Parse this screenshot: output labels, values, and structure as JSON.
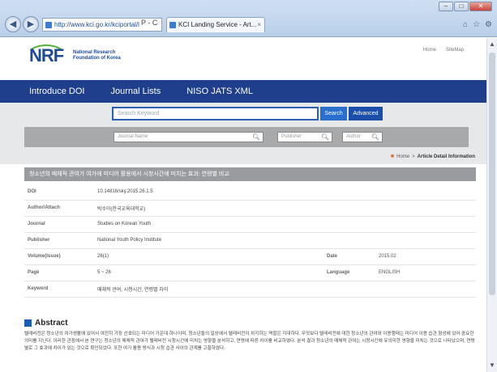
{
  "browser": {
    "address_url": "http://www.kci.go.kr/kciportal/land",
    "address_tools": "P - C",
    "tab_title": "KCI Landing Service - Art...",
    "tab_close": "×",
    "back_icon": "back-arrow-icon",
    "forward_icon": "forward-arrow-icon"
  },
  "header": {
    "logo_text": "NRF",
    "logo_line1": "National Research",
    "logo_line2": "Foundation of Korea",
    "util_home": "Home",
    "util_sitemap": "SiteMap"
  },
  "nav": {
    "items": [
      "Introduce DOI",
      "Journal Lists",
      "NISO JATS XML"
    ]
  },
  "search": {
    "placeholder": "Search Keyword",
    "search_label": "Search",
    "advanced_label": "Advanced",
    "journal_name": "Journal Name",
    "publisher": "Publisher",
    "author": "Author"
  },
  "breadcrumb": {
    "home": "Home",
    "sep": ">",
    "current": "Article Detail Information"
  },
  "article": {
    "title": "청소년의 매체적 관여가 여가에 미디어 활용에서 시청시간에 미치는 효과: 연령별 비교",
    "doi_label": "DOI",
    "doi": "10.14816/sky.2015.26.1.5",
    "author_label": "Author/Attach",
    "author": "박수아(한국교육대학교)",
    "journal_label": "Journal",
    "journal": "Studies on Korean Youth",
    "publisher_label": "Publisher",
    "publisher": "National Youth Policy Institute",
    "volume_label": "Volume(Issue)",
    "volume": "26(1)",
    "date_label": "Date",
    "date": "2015.02",
    "page_label": "Page",
    "page": "5 ~ 26",
    "language_label": "Language",
    "language": "ENGLISH",
    "keyword_label": "Keyword",
    "keyword": "매체적 관여, 시청시간, 연령별 차이"
  },
  "abstract": {
    "heading": "Abstract",
    "body": "텔레비전은 청소년의 여가생활에 있어서 여전히 가장 선호되는 미디어 가운데 하나이며, 청소년들의 일상에서 텔레비전이 차지하는 역할은 지대하다. 무엇보다 텔레비전에 대한 청소년의 관여와 이용행태는 미디어 이용 습관 형성에 있어 중요한 의미를 지닌다. 이러한 관점에서 본 연구는 청소년의 매체적 관여가 텔레비전 시청시간에 미치는 영향을 분석하고, 연령에 따른 차이를 비교하였다. 분석 결과 청소년의 매체적 관여는 시청시간에 유의미한 영향을 미치는 것으로 나타났으며, 연령별로 그 효과에 차이가 있는 것으로 확인되었다. 또한 여가 활용 방식과 시청 습관 사이의 관계를 고찰하였다."
  }
}
